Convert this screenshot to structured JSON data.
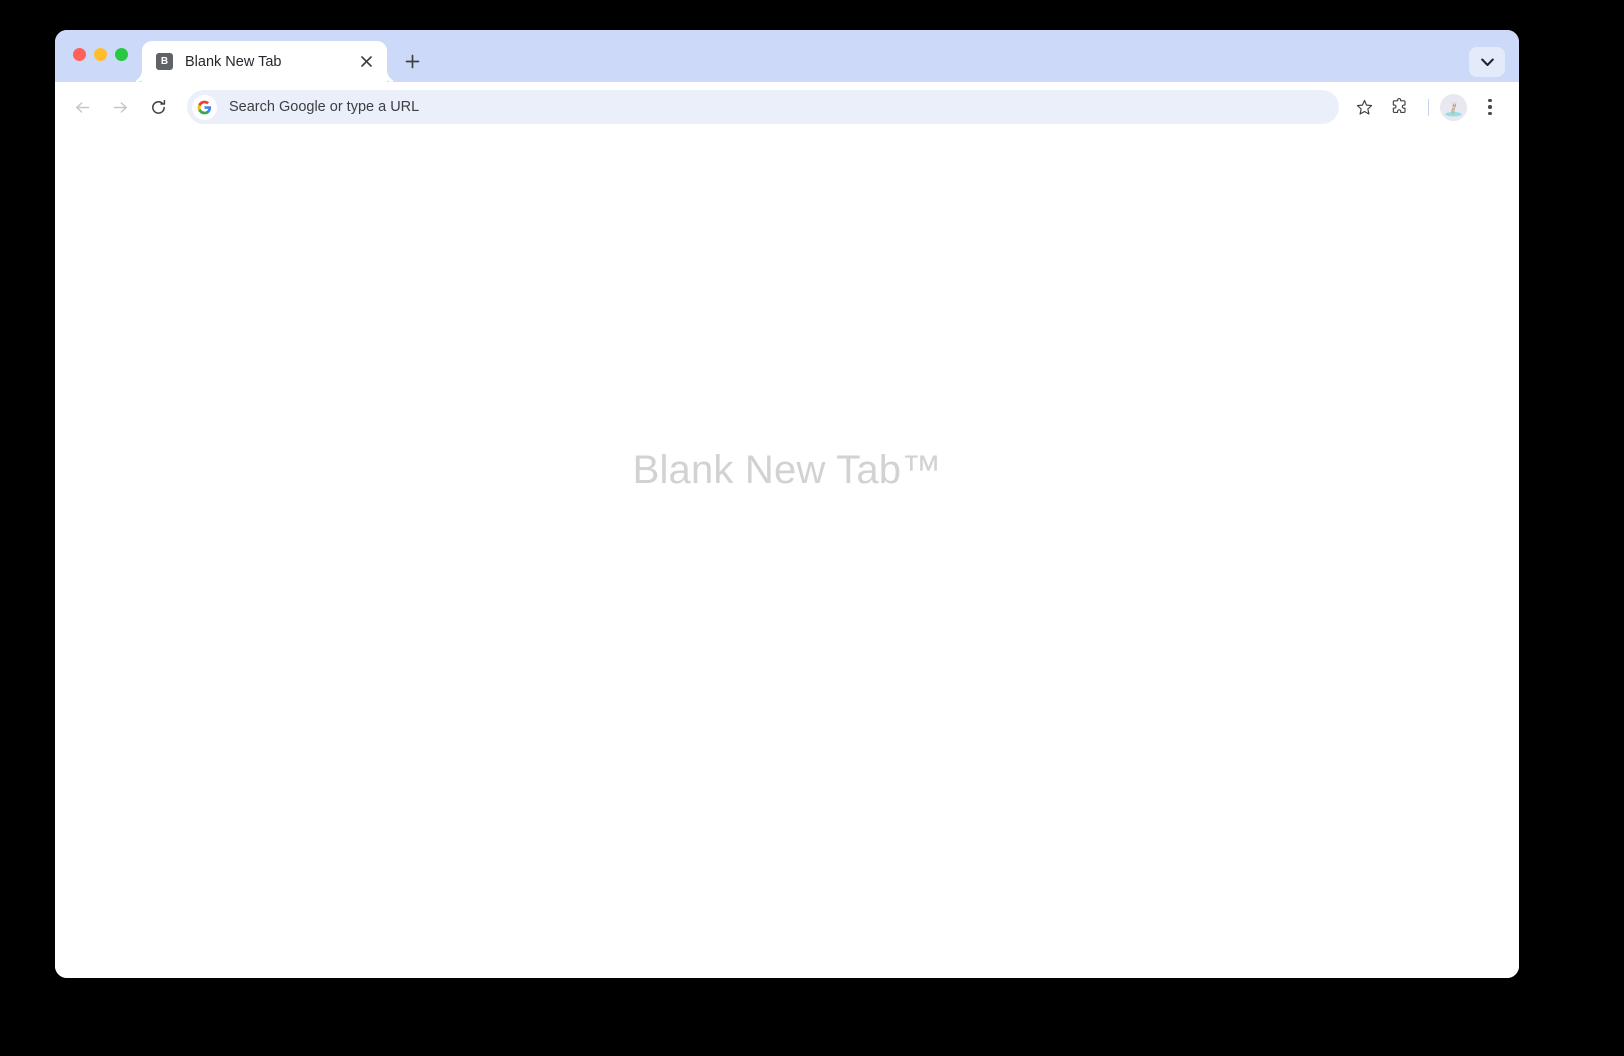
{
  "window": {
    "traffic_lights": [
      {
        "name": "close",
        "color": "#ff6159"
      },
      {
        "name": "minimize",
        "color": "#ffbd2e"
      },
      {
        "name": "maximize",
        "color": "#28c940"
      }
    ]
  },
  "tab_strip": {
    "background_color": "#ccd9f8",
    "tabs": [
      {
        "title": "Blank New Tab",
        "favicon_letter": "B",
        "favicon_bg": "#5f6368",
        "active": true,
        "close_label": "Close tab"
      }
    ],
    "new_tab_button_label": "New Tab",
    "tab_search_button_label": "Search tabs"
  },
  "toolbar": {
    "back_label": "Back",
    "forward_label": "Forward",
    "reload_label": "Reload",
    "bookmark_label": "Bookmark this tab",
    "extensions_label": "Extensions",
    "profile_label": "Profile",
    "menu_label": "Customize and control Google Chrome",
    "omnibox": {
      "value": "",
      "placeholder": "Search Google or type a URL",
      "search_engine_icon": "google-g-icon",
      "background_color": "#ebeffa"
    }
  },
  "page": {
    "heading": "Blank New Tab™",
    "heading_color": "#d2d2d2",
    "background_color": "#ffffff"
  }
}
